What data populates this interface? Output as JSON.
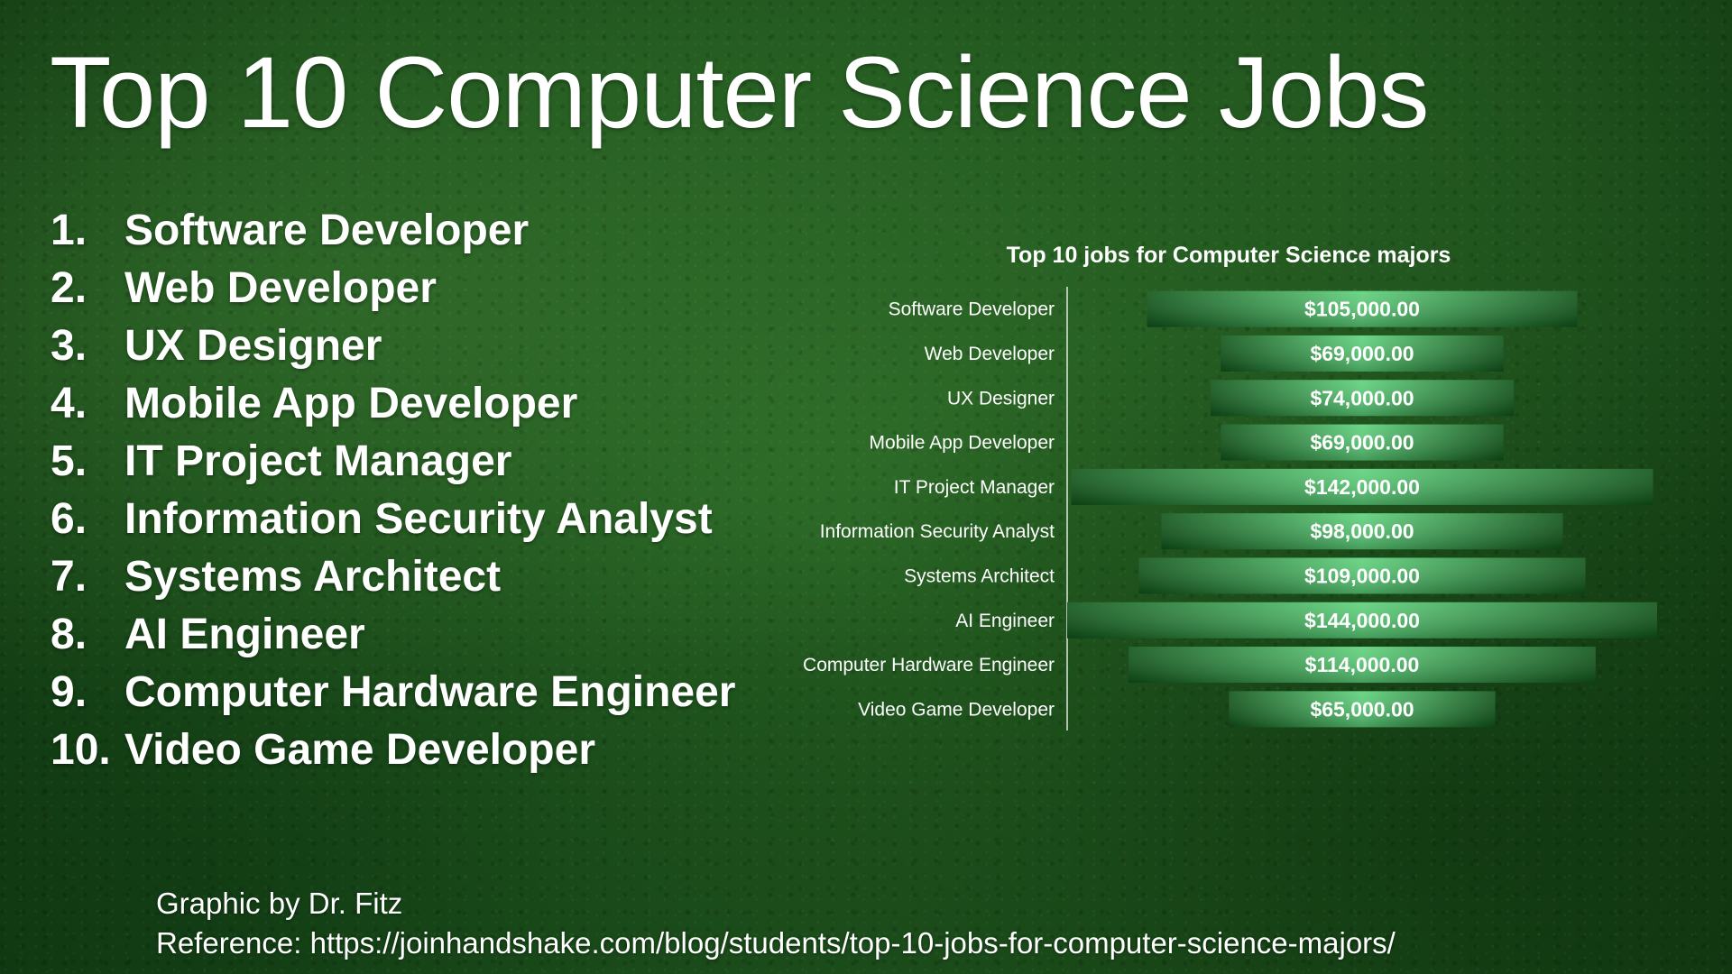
{
  "title": "Top 10 Computer Science Jobs",
  "list": [
    {
      "number": "1.",
      "label": "Software Developer"
    },
    {
      "number": "2.",
      "label": "Web Developer"
    },
    {
      "number": "3.",
      "label": "UX Designer"
    },
    {
      "number": "4.",
      "label": "Mobile App Developer"
    },
    {
      "number": "5.",
      "label": "IT Project Manager"
    },
    {
      "number": "6.",
      "label": "Information Security Analyst"
    },
    {
      "number": "7.",
      "label": "Systems Architect"
    },
    {
      "number": "8.",
      "label": "AI Engineer"
    },
    {
      "number": "9.",
      "label": "Computer Hardware Engineer"
    },
    {
      "number": "10.",
      "label": "Video Game Developer"
    }
  ],
  "footer": {
    "credit": "Graphic by Dr. Fitz",
    "reference": "Reference: https://joinhandshake.com/blog/students/top-10-jobs-for-computer-science-majors/"
  },
  "colors": {
    "bar_dark": "#0f5418",
    "bar_light": "#5cd17a",
    "axis": "#dfe9dc"
  },
  "chart_data": {
    "type": "bar",
    "orientation": "horizontal",
    "title": "Top 10 jobs for Computer Science majors",
    "categories": [
      "Software Developer",
      "Web Developer",
      "UX Designer",
      "Mobile App Developer",
      "IT Project Manager",
      "Information Security Analyst",
      "Systems Architect",
      "AI Engineer",
      "Computer Hardware Engineer",
      "Video Game Developer"
    ],
    "values": [
      105000,
      69000,
      74000,
      69000,
      142000,
      98000,
      109000,
      144000,
      114000,
      65000
    ],
    "value_labels": [
      "$105,000.00",
      "$69,000.00",
      "$74,000.00",
      "$69,000.00",
      "$142,000.00",
      "$98,000.00",
      "$109,000.00",
      "$144,000.00",
      "$114,000.00",
      "$65,000.00"
    ],
    "style": "funnel (bars centered)",
    "xlim": [
      0,
      144000
    ],
    "grid": false,
    "legend": "none"
  }
}
